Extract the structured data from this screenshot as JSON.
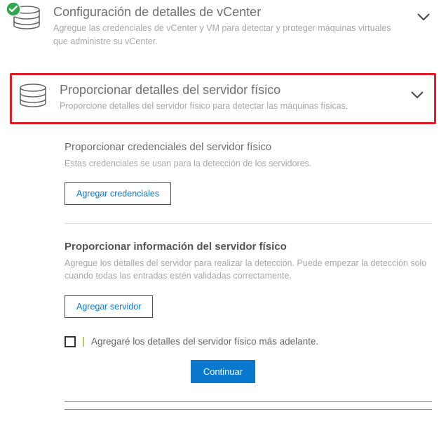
{
  "section_vcenter": {
    "title": "Configuración de detalles de vCenter",
    "desc": "Agregue las credenciales de vCenter y VM para detectar y proteger máquinas virtuales que administre su vCenter."
  },
  "section_physical": {
    "title": "Proporcionar detalles del servidor físico",
    "desc": "Proporcione detalles del servidor físico para detectar las máquinas físicas."
  },
  "creds_block": {
    "title": "Proporcionar credenciales del servidor físico",
    "desc": "Estas credenciales se usan para la detección de los servidores.",
    "button": "Agregar credenciales"
  },
  "info_block": {
    "title": "Proporcionar información del servidor físico",
    "desc": "Agregue los detalles del servidor para realizar la detección. Puede empezar la detección solo cuando todas las entradas estén validadas correctamente.",
    "button": "Agregar servidor"
  },
  "defer_checkbox_label": "Agregaré los detalles del servidor físico más adelante.",
  "continue_button": "Continuar"
}
